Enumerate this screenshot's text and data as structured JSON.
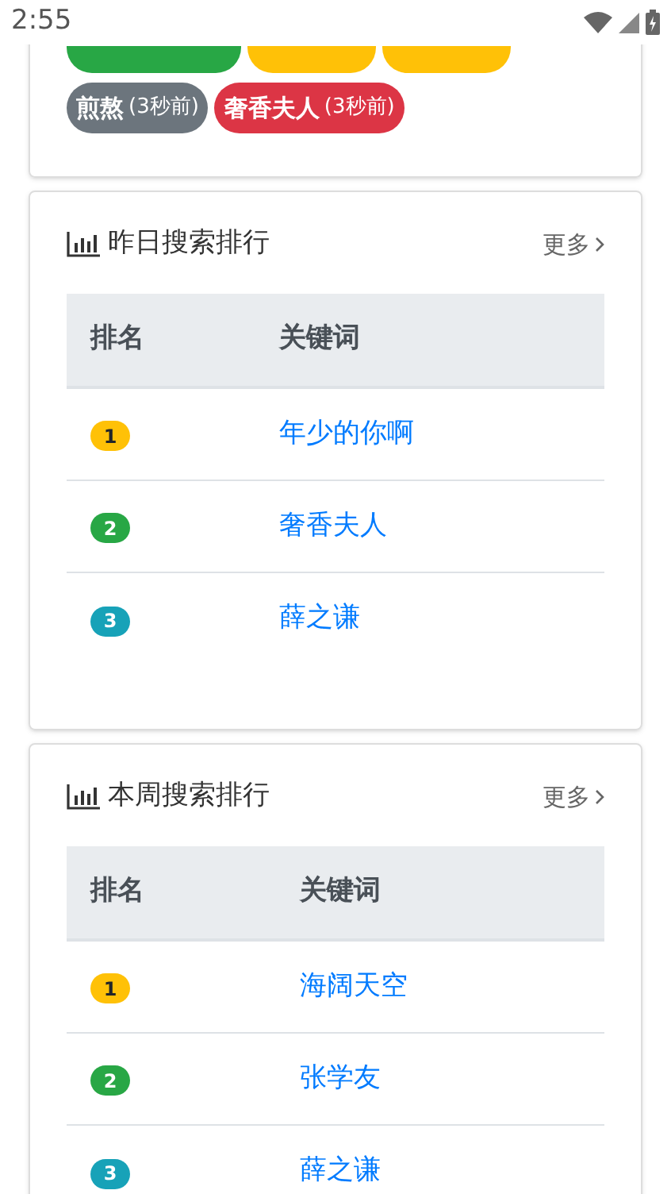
{
  "status_bar": {
    "time": "2:55"
  },
  "recent_searches": [
    {
      "color": "#28a745"
    },
    {
      "color": "#ffc107"
    },
    {
      "color": "#ffc107"
    },
    {
      "word": "煎熬",
      "time": "(3秒前)",
      "color": "#6c757d"
    },
    {
      "word": "奢香夫人",
      "time": "(3秒前)",
      "color": "#dc3545"
    }
  ],
  "rankings": [
    {
      "title": "昨日搜索排行",
      "more": "更多",
      "columns": [
        "排名",
        "关键词"
      ],
      "rows": [
        {
          "rank": "1",
          "keyword": "年少的你啊",
          "color": "#ffc107"
        },
        {
          "rank": "2",
          "keyword": "奢香夫人",
          "color": "#28a745"
        },
        {
          "rank": "3",
          "keyword": "薛之谦",
          "color": "#17a2b8"
        }
      ]
    },
    {
      "title": "本周搜索排行",
      "more": "更多",
      "columns": [
        "排名",
        "关键词"
      ],
      "rows": [
        {
          "rank": "1",
          "keyword": "海阔天空",
          "color": "#ffc107"
        },
        {
          "rank": "2",
          "keyword": "张学友",
          "color": "#28a745"
        },
        {
          "rank": "3",
          "keyword": "薛之谦",
          "color": "#17a2b8"
        }
      ]
    }
  ]
}
